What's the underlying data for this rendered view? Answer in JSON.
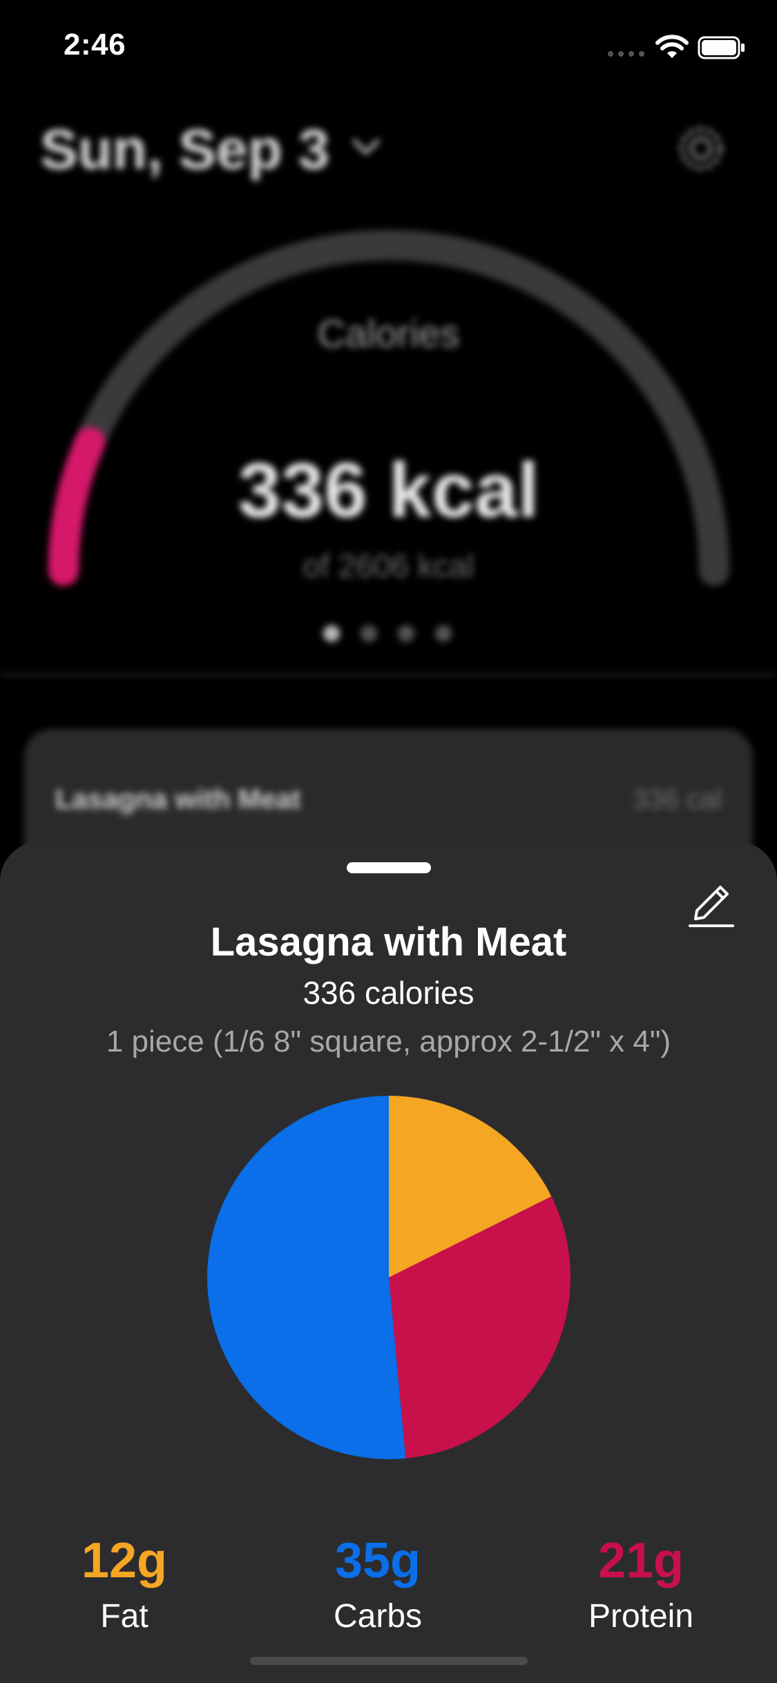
{
  "status": {
    "time": "2:46"
  },
  "header": {
    "date": "Sun, Sep 3"
  },
  "gauge": {
    "label": "Calories",
    "value": "336 kcal",
    "goal": "of 2606 kcal",
    "progress": 0.129,
    "color": "#d6186b"
  },
  "pager": {
    "count": 4,
    "active": 0
  },
  "entry": {
    "name": "Lasagna with Meat",
    "calories": "336 cal"
  },
  "sheet": {
    "title": "Lasagna with Meat",
    "calories": "336 calories",
    "serving": "1 piece (1/6 8\" square, approx 2-1/2\" x 4\")"
  },
  "chart_data": {
    "type": "pie",
    "categories": [
      "Fat",
      "Protein",
      "Carbs"
    ],
    "values": [
      12,
      21,
      35
    ],
    "colors": [
      "#f5a623",
      "#c8104b",
      "#0a6fe8"
    ]
  },
  "macros": [
    {
      "amount": "12g",
      "label": "Fat",
      "color": "#f5a623"
    },
    {
      "amount": "35g",
      "label": "Carbs",
      "color": "#0a6fe8"
    },
    {
      "amount": "21g",
      "label": "Protein",
      "color": "#c8104b"
    }
  ]
}
